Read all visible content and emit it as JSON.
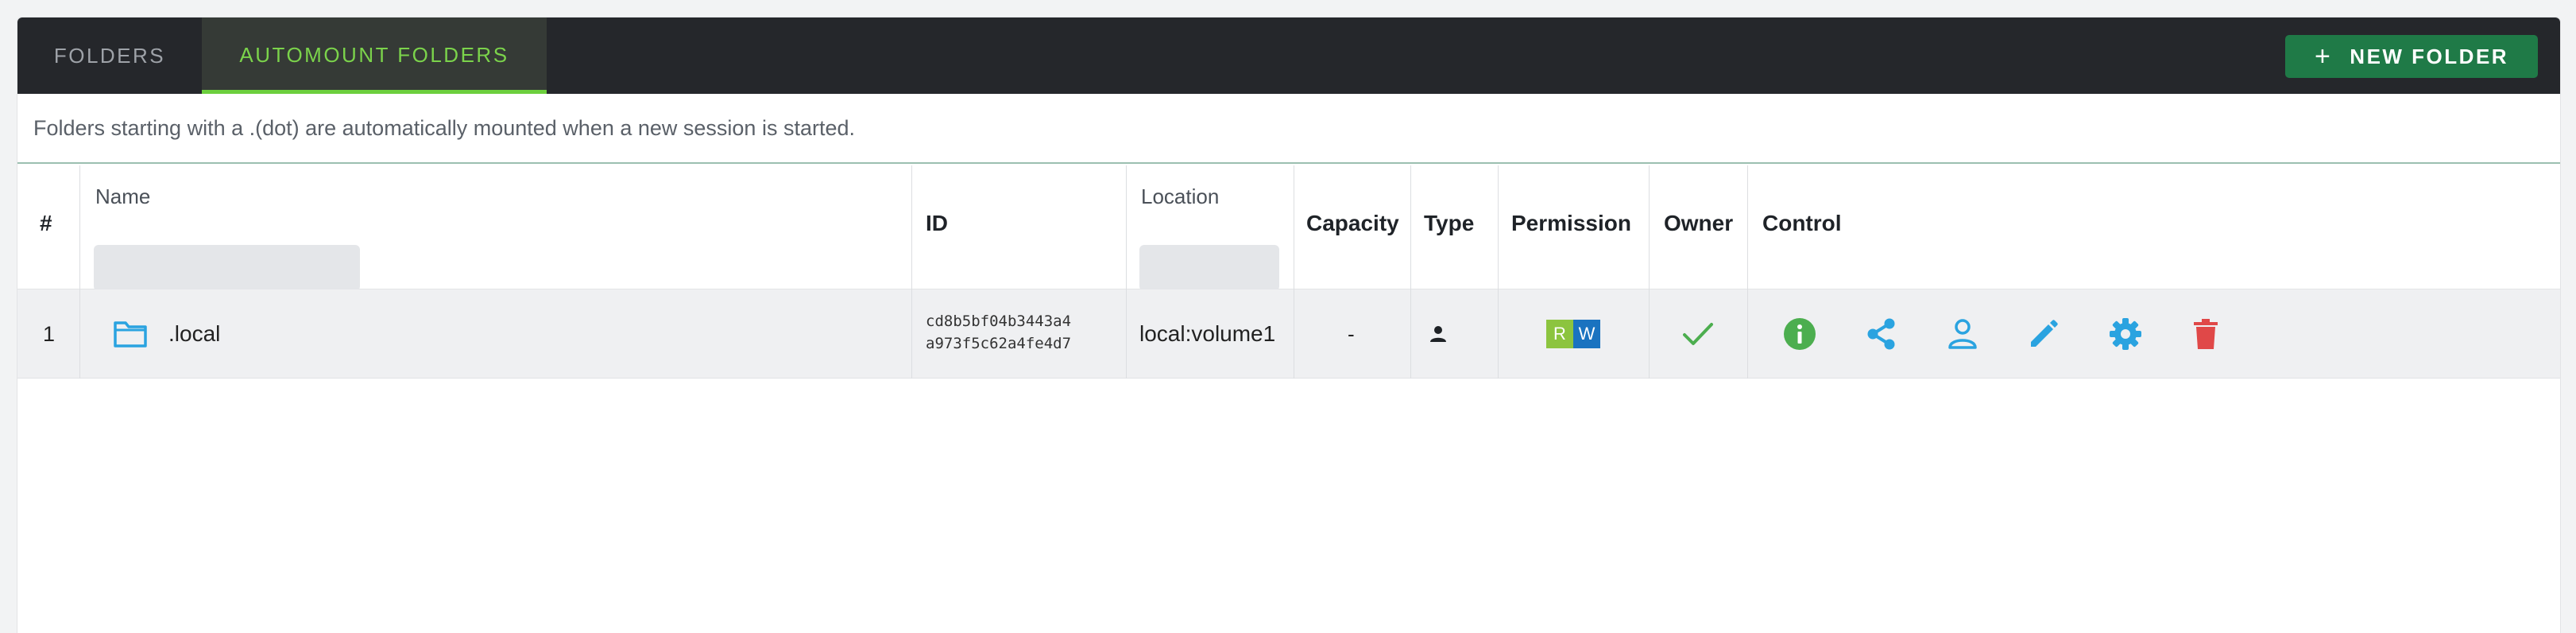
{
  "tabs": [
    {
      "label": "FOLDERS",
      "active": false
    },
    {
      "label": "AUTOMOUNT FOLDERS",
      "active": true
    }
  ],
  "new_folder_button": {
    "label": "NEW FOLDER",
    "icon": "plus-icon"
  },
  "notice": "Folders starting with a .(dot) are automatically mounted when a new session is started.",
  "table": {
    "columns": {
      "index": "#",
      "name": "Name",
      "id": "ID",
      "location": "Location",
      "capacity": "Capacity",
      "type": "Type",
      "permission": "Permission",
      "owner": "Owner",
      "control": "Control"
    },
    "filters": {
      "name": "",
      "location": ""
    },
    "rows": [
      {
        "index": "1",
        "name": ".local",
        "name_icon": "folder-icon",
        "id_line1": "cd8b5bf04b3443a4",
        "id_line2": "a973f5c62a4fe4d7",
        "location": "local:volume1",
        "capacity": "-",
        "type_icon": "user-icon",
        "permission": {
          "read": "R",
          "write": "W"
        },
        "owner_icon": "check-icon",
        "controls": [
          "info-icon",
          "share-icon",
          "user-icon",
          "edit-icon",
          "settings-icon",
          "delete-icon"
        ]
      }
    ]
  },
  "colors": {
    "topbar": "#25272b",
    "accent_green": "#6ccf3d",
    "button_green": "#1f7a47",
    "icon_blue": "#2aa3e0",
    "info_green": "#4cae4f",
    "delete_red": "#e04848",
    "perm_r": "#8cc43f",
    "perm_w": "#1a73c0"
  }
}
